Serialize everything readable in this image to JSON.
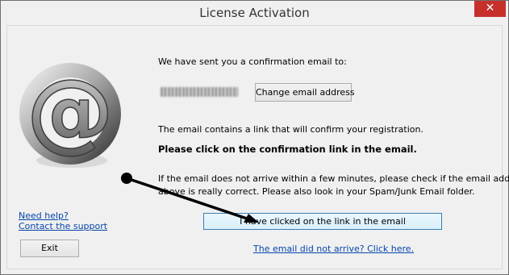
{
  "window": {
    "title": "License Activation",
    "close_symbol": "✕"
  },
  "content": {
    "sent_text": "We have sent you a confirmation email to:",
    "email_blurred": "",
    "change_email_label": "Change email address",
    "link_info": "The email contains a link that will confirm your registration.",
    "click_instruction": "Please click on the confirmation link in the email.",
    "arrive_line1": "If the email does not arrive within a few minutes, please check if the email address",
    "arrive_line2": "above is really correct. Please also look in your Spam/Junk Email folder.",
    "clicked_button_label": "I have clicked on the link in the email",
    "not_arrived_link": "The email did not arrive? Click here."
  },
  "sidebar": {
    "need_help": "Need help?",
    "contact_support": "Contact the support",
    "exit_label": "Exit"
  },
  "icons": {
    "logo": "at-sign-icon",
    "annotation": "arrow-annotation"
  },
  "colors": {
    "link": "#0645ad",
    "close": "#c7302a",
    "primary_border": "#3c7fb1"
  }
}
